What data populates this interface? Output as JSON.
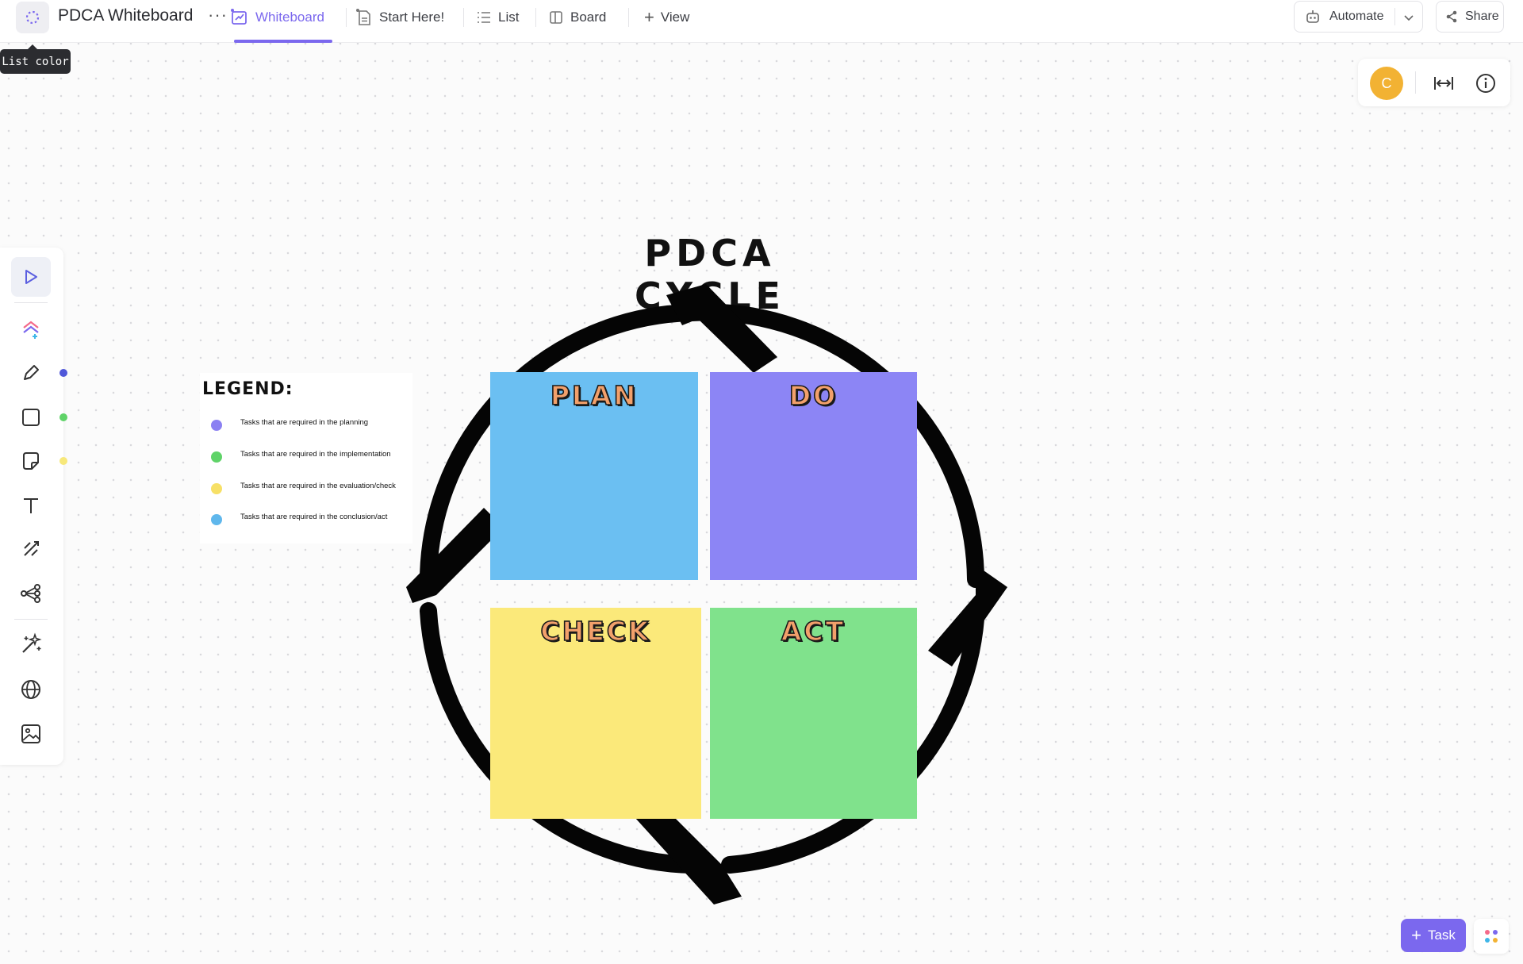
{
  "header": {
    "title": "PDCA Whiteboard",
    "more": "···",
    "tabs": [
      {
        "label": "Whiteboard"
      },
      {
        "label": "Start Here!"
      },
      {
        "label": "List"
      },
      {
        "label": "Board"
      }
    ],
    "add_view": "View",
    "automate": "Automate",
    "share": "Share",
    "accent_color": "#7b68ee"
  },
  "tooltip": "List color",
  "right_panel": {
    "avatar_initial": "C",
    "avatar_color": "#f2b233",
    "fit_icon": "fit-width-icon",
    "info_icon": "info-icon"
  },
  "toolbar": {
    "tools": [
      "select-icon",
      "ai-create-icon",
      "pen-icon",
      "shape-icon",
      "sticky-note-icon",
      "text-icon",
      "connector-icon",
      "mind-map-icon",
      "magic-icon",
      "embed-icon",
      "image-icon"
    ],
    "pen_color": "#4f57d9",
    "shape_color": "#5fd368",
    "sticky_color": "#f7e87a"
  },
  "canvas": {
    "cycle_title": "PDCA CYCLE",
    "legend": {
      "title": "LEGEND:",
      "items": [
        {
          "text": "Tasks that are required in the planning",
          "color": "#8b80f2"
        },
        {
          "text": "Tasks that are required in the implementation",
          "color": "#5fd368"
        },
        {
          "text": "Tasks that are required in the evaluation/check",
          "color": "#f7e066"
        },
        {
          "text": "Tasks that are required in the conclusion/act",
          "color": "#5fb7ec"
        }
      ]
    },
    "stickies": [
      {
        "label": "PLAN",
        "color": "#6bbff2"
      },
      {
        "label": "DO",
        "color": "#8c85f5"
      },
      {
        "label": "CHECK",
        "color": "#fbe97a"
      },
      {
        "label": "ACT",
        "color": "#80e28c"
      }
    ]
  },
  "footer": {
    "task_button": "Task",
    "apps_icon": "apps-icon"
  }
}
